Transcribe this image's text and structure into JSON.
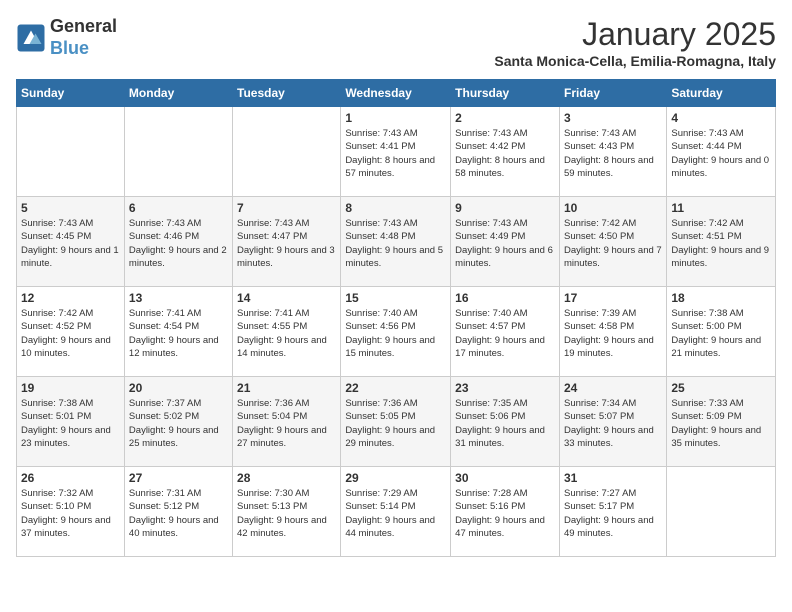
{
  "logo": {
    "line1": "General",
    "line2": "Blue"
  },
  "title": "January 2025",
  "subtitle": "Santa Monica-Cella, Emilia-Romagna, Italy",
  "weekdays": [
    "Sunday",
    "Monday",
    "Tuesday",
    "Wednesday",
    "Thursday",
    "Friday",
    "Saturday"
  ],
  "weeks": [
    [
      {
        "day": "",
        "sunrise": "",
        "sunset": "",
        "daylight": ""
      },
      {
        "day": "",
        "sunrise": "",
        "sunset": "",
        "daylight": ""
      },
      {
        "day": "",
        "sunrise": "",
        "sunset": "",
        "daylight": ""
      },
      {
        "day": "1",
        "sunrise": "Sunrise: 7:43 AM",
        "sunset": "Sunset: 4:41 PM",
        "daylight": "Daylight: 8 hours and 57 minutes."
      },
      {
        "day": "2",
        "sunrise": "Sunrise: 7:43 AM",
        "sunset": "Sunset: 4:42 PM",
        "daylight": "Daylight: 8 hours and 58 minutes."
      },
      {
        "day": "3",
        "sunrise": "Sunrise: 7:43 AM",
        "sunset": "Sunset: 4:43 PM",
        "daylight": "Daylight: 8 hours and 59 minutes."
      },
      {
        "day": "4",
        "sunrise": "Sunrise: 7:43 AM",
        "sunset": "Sunset: 4:44 PM",
        "daylight": "Daylight: 9 hours and 0 minutes."
      }
    ],
    [
      {
        "day": "5",
        "sunrise": "Sunrise: 7:43 AM",
        "sunset": "Sunset: 4:45 PM",
        "daylight": "Daylight: 9 hours and 1 minute."
      },
      {
        "day": "6",
        "sunrise": "Sunrise: 7:43 AM",
        "sunset": "Sunset: 4:46 PM",
        "daylight": "Daylight: 9 hours and 2 minutes."
      },
      {
        "day": "7",
        "sunrise": "Sunrise: 7:43 AM",
        "sunset": "Sunset: 4:47 PM",
        "daylight": "Daylight: 9 hours and 3 minutes."
      },
      {
        "day": "8",
        "sunrise": "Sunrise: 7:43 AM",
        "sunset": "Sunset: 4:48 PM",
        "daylight": "Daylight: 9 hours and 5 minutes."
      },
      {
        "day": "9",
        "sunrise": "Sunrise: 7:43 AM",
        "sunset": "Sunset: 4:49 PM",
        "daylight": "Daylight: 9 hours and 6 minutes."
      },
      {
        "day": "10",
        "sunrise": "Sunrise: 7:42 AM",
        "sunset": "Sunset: 4:50 PM",
        "daylight": "Daylight: 9 hours and 7 minutes."
      },
      {
        "day": "11",
        "sunrise": "Sunrise: 7:42 AM",
        "sunset": "Sunset: 4:51 PM",
        "daylight": "Daylight: 9 hours and 9 minutes."
      }
    ],
    [
      {
        "day": "12",
        "sunrise": "Sunrise: 7:42 AM",
        "sunset": "Sunset: 4:52 PM",
        "daylight": "Daylight: 9 hours and 10 minutes."
      },
      {
        "day": "13",
        "sunrise": "Sunrise: 7:41 AM",
        "sunset": "Sunset: 4:54 PM",
        "daylight": "Daylight: 9 hours and 12 minutes."
      },
      {
        "day": "14",
        "sunrise": "Sunrise: 7:41 AM",
        "sunset": "Sunset: 4:55 PM",
        "daylight": "Daylight: 9 hours and 14 minutes."
      },
      {
        "day": "15",
        "sunrise": "Sunrise: 7:40 AM",
        "sunset": "Sunset: 4:56 PM",
        "daylight": "Daylight: 9 hours and 15 minutes."
      },
      {
        "day": "16",
        "sunrise": "Sunrise: 7:40 AM",
        "sunset": "Sunset: 4:57 PM",
        "daylight": "Daylight: 9 hours and 17 minutes."
      },
      {
        "day": "17",
        "sunrise": "Sunrise: 7:39 AM",
        "sunset": "Sunset: 4:58 PM",
        "daylight": "Daylight: 9 hours and 19 minutes."
      },
      {
        "day": "18",
        "sunrise": "Sunrise: 7:38 AM",
        "sunset": "Sunset: 5:00 PM",
        "daylight": "Daylight: 9 hours and 21 minutes."
      }
    ],
    [
      {
        "day": "19",
        "sunrise": "Sunrise: 7:38 AM",
        "sunset": "Sunset: 5:01 PM",
        "daylight": "Daylight: 9 hours and 23 minutes."
      },
      {
        "day": "20",
        "sunrise": "Sunrise: 7:37 AM",
        "sunset": "Sunset: 5:02 PM",
        "daylight": "Daylight: 9 hours and 25 minutes."
      },
      {
        "day": "21",
        "sunrise": "Sunrise: 7:36 AM",
        "sunset": "Sunset: 5:04 PM",
        "daylight": "Daylight: 9 hours and 27 minutes."
      },
      {
        "day": "22",
        "sunrise": "Sunrise: 7:36 AM",
        "sunset": "Sunset: 5:05 PM",
        "daylight": "Daylight: 9 hours and 29 minutes."
      },
      {
        "day": "23",
        "sunrise": "Sunrise: 7:35 AM",
        "sunset": "Sunset: 5:06 PM",
        "daylight": "Daylight: 9 hours and 31 minutes."
      },
      {
        "day": "24",
        "sunrise": "Sunrise: 7:34 AM",
        "sunset": "Sunset: 5:07 PM",
        "daylight": "Daylight: 9 hours and 33 minutes."
      },
      {
        "day": "25",
        "sunrise": "Sunrise: 7:33 AM",
        "sunset": "Sunset: 5:09 PM",
        "daylight": "Daylight: 9 hours and 35 minutes."
      }
    ],
    [
      {
        "day": "26",
        "sunrise": "Sunrise: 7:32 AM",
        "sunset": "Sunset: 5:10 PM",
        "daylight": "Daylight: 9 hours and 37 minutes."
      },
      {
        "day": "27",
        "sunrise": "Sunrise: 7:31 AM",
        "sunset": "Sunset: 5:12 PM",
        "daylight": "Daylight: 9 hours and 40 minutes."
      },
      {
        "day": "28",
        "sunrise": "Sunrise: 7:30 AM",
        "sunset": "Sunset: 5:13 PM",
        "daylight": "Daylight: 9 hours and 42 minutes."
      },
      {
        "day": "29",
        "sunrise": "Sunrise: 7:29 AM",
        "sunset": "Sunset: 5:14 PM",
        "daylight": "Daylight: 9 hours and 44 minutes."
      },
      {
        "day": "30",
        "sunrise": "Sunrise: 7:28 AM",
        "sunset": "Sunset: 5:16 PM",
        "daylight": "Daylight: 9 hours and 47 minutes."
      },
      {
        "day": "31",
        "sunrise": "Sunrise: 7:27 AM",
        "sunset": "Sunset: 5:17 PM",
        "daylight": "Daylight: 9 hours and 49 minutes."
      },
      {
        "day": "",
        "sunrise": "",
        "sunset": "",
        "daylight": ""
      }
    ]
  ]
}
